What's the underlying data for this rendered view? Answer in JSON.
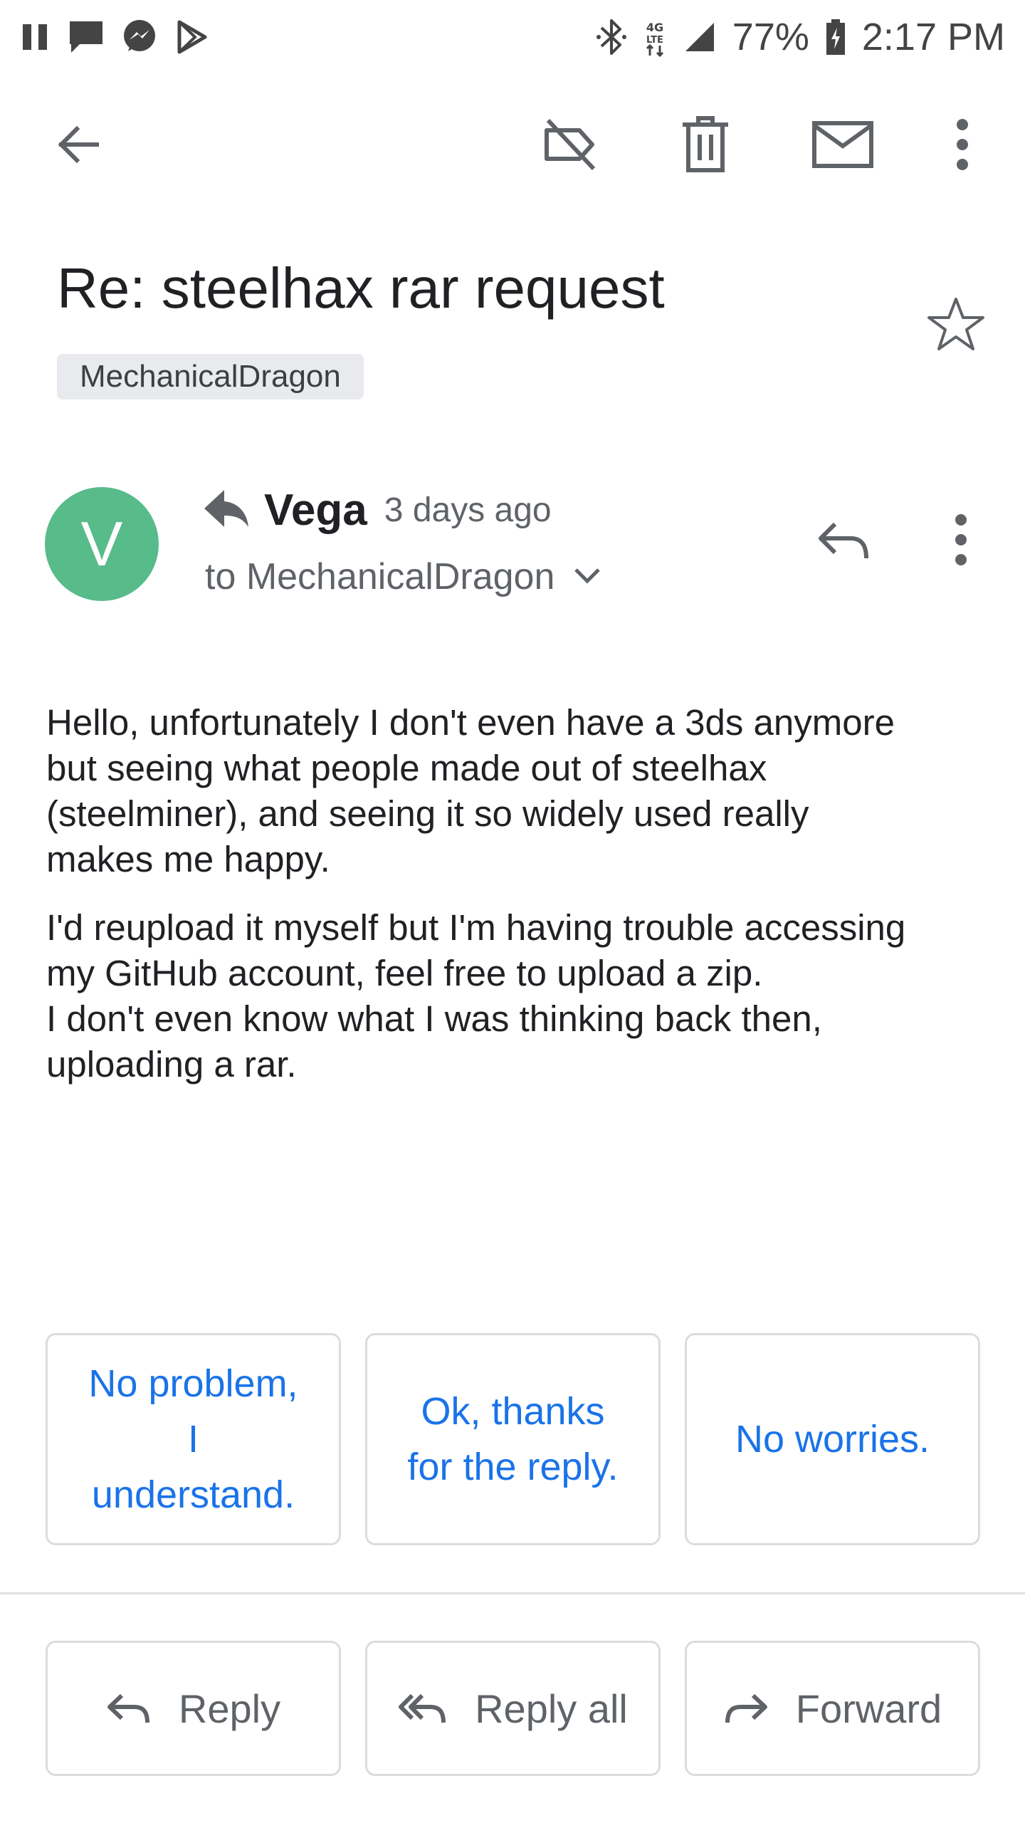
{
  "status_bar": {
    "battery": "77%",
    "time": "2:17 PM",
    "left_icons": [
      "pause-icon",
      "chat-icon",
      "messenger-icon",
      "play-store-icon"
    ],
    "right_icons": [
      "bluetooth-icon",
      "lte-icon",
      "signal-icon",
      "battery-icon"
    ]
  },
  "toolbar": {
    "icons": [
      "back-arrow-icon",
      "label-off-icon",
      "trash-icon",
      "mail-icon",
      "more-vert-icon"
    ]
  },
  "email": {
    "subject": "Re: steelhax rar request",
    "label": "MechanicalDragon",
    "sender": {
      "initial": "V",
      "name": "Vega",
      "time": "3 days ago",
      "recipient": "to MechanicalDragon",
      "avatar_color": "#57bb8a"
    },
    "body": {
      "paragraph1": [
        "Hello, unfortunately I don't even have a 3ds anymore",
        "but seeing what people made out of steelhax",
        "(steelminer), and seeing it so widely used really",
        "makes me happy."
      ],
      "paragraph2": [
        "I'd reupload it myself but I'm having trouble accessing",
        "my GitHub account, feel free to upload a zip.",
        "I don't even know what I was thinking back then,",
        "uploading a rar."
      ]
    }
  },
  "smart_replies": [
    {
      "lines": [
        "No problem,",
        "I",
        "understand."
      ]
    },
    {
      "lines": [
        "Ok, thanks",
        "for the reply."
      ]
    },
    {
      "lines": [
        "No worries."
      ]
    }
  ],
  "actions": {
    "reply": "Reply",
    "reply_all": "Reply all",
    "forward": "Forward"
  },
  "colors": {
    "accent_blue": "#1a73e8",
    "icon_gray": "#5f6368",
    "avatar_green": "#57bb8a"
  }
}
